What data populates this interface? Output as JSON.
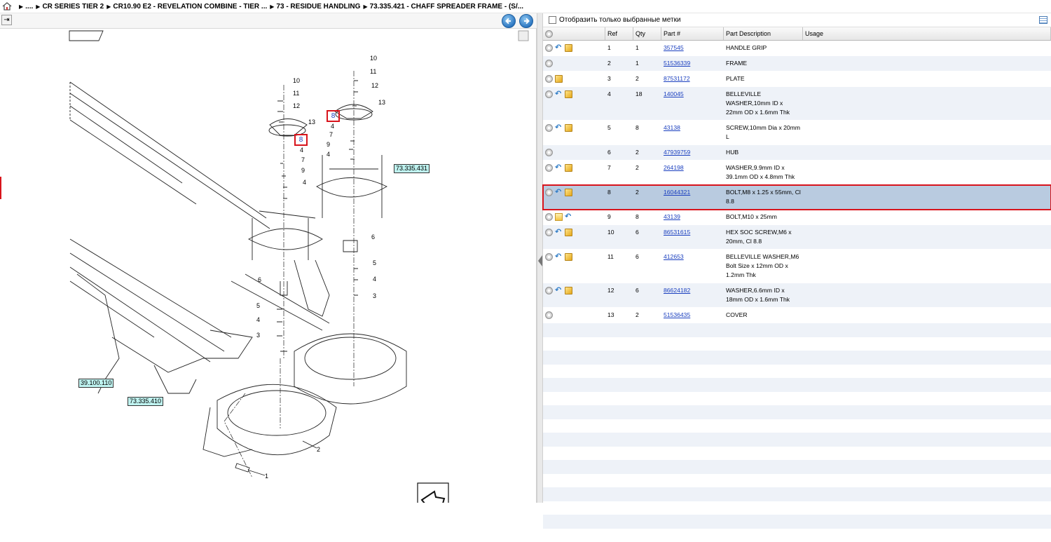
{
  "breadcrumb": {
    "items": [
      "....",
      "CR SERIES TIER 2",
      "CR10.90 E2 - REVELATION COMBINE - TIER ...",
      "73 - RESIDUE HANDLING",
      "73.335.421 - CHAFF SPREADER FRAME - (S/..."
    ]
  },
  "filter": {
    "label": "Отобразить только выбранные метки"
  },
  "table": {
    "columns": {
      "ref": "Ref",
      "qty": "Qty",
      "part": "Part #",
      "desc": "Part Description",
      "usage": "Usage"
    },
    "rows": [
      {
        "icons": [
          "plus-icon",
          "undo-icon",
          "box-icon"
        ],
        "ref": "1",
        "qty": "1",
        "part": "357545",
        "desc": "HANDLE GRIP",
        "usage": ""
      },
      {
        "icons": [
          "plus-icon"
        ],
        "ref": "2",
        "qty": "1",
        "part": "51536339",
        "desc": "FRAME",
        "usage": ""
      },
      {
        "icons": [
          "plus-icon",
          "box-icon"
        ],
        "ref": "3",
        "qty": "2",
        "part": "87531172",
        "desc": "PLATE",
        "usage": ""
      },
      {
        "icons": [
          "plus-icon",
          "undo-icon",
          "box-icon"
        ],
        "ref": "4",
        "qty": "18",
        "part": "140045",
        "desc": "BELLEVILLE WASHER,10mm ID x 22mm OD x 1.6mm Thk",
        "usage": ""
      },
      {
        "icons": [
          "plus-icon",
          "undo-icon",
          "box-icon"
        ],
        "ref": "5",
        "qty": "8",
        "part": "43138",
        "desc": "SCREW,10mm Dia x 20mm L",
        "usage": ""
      },
      {
        "icons": [
          "plus-icon"
        ],
        "ref": "6",
        "qty": "2",
        "part": "47939759",
        "desc": "HUB",
        "usage": ""
      },
      {
        "icons": [
          "plus-icon",
          "undo-icon",
          "box-icon"
        ],
        "ref": "7",
        "qty": "2",
        "part": "264198",
        "desc": "WASHER,9.9mm ID x 39.1mm OD x 4.8mm Thk",
        "usage": ""
      },
      {
        "icons": [
          "plus-icon",
          "undo-icon",
          "box-icon"
        ],
        "ref": "8",
        "qty": "2",
        "part": "16044321",
        "desc": "BOLT,M8 x 1.25 x 55mm, Cl 8.8",
        "usage": "",
        "selected": true
      },
      {
        "icons": [
          "plus-icon",
          "doc-icon",
          "undo-icon"
        ],
        "ref": "9",
        "qty": "8",
        "part": "43139",
        "desc": "BOLT,M10 x 25mm",
        "usage": ""
      },
      {
        "icons": [
          "plus-icon",
          "undo-icon",
          "box-icon"
        ],
        "ref": "10",
        "qty": "6",
        "part": "86531615",
        "desc": "HEX SOC SCREW,M6 x 20mm, Cl 8.8",
        "usage": ""
      },
      {
        "icons": [
          "plus-icon",
          "undo-icon",
          "box-icon"
        ],
        "ref": "11",
        "qty": "6",
        "part": "412653",
        "desc": "BELLEVILLE WASHER,M6 Bolt Size x 12mm OD x 1.2mm Thk",
        "usage": ""
      },
      {
        "icons": [
          "plus-icon",
          "undo-icon",
          "box-icon"
        ],
        "ref": "12",
        "qty": "6",
        "part": "86624182",
        "desc": "WASHER,6.6mm ID x 18mm OD x 1.6mm Thk",
        "usage": ""
      },
      {
        "icons": [
          "plus-icon"
        ],
        "ref": "13",
        "qty": "2",
        "part": "51536435",
        "desc": "COVER",
        "usage": ""
      }
    ]
  },
  "drawing": {
    "callouts": [
      "73.335.431",
      "39.100.110",
      "73.335.410"
    ],
    "markers": [
      "8",
      "8"
    ],
    "labels": [
      "10",
      "11",
      "12",
      "13",
      "10",
      "11",
      "12",
      "13",
      "4",
      "7",
      "9",
      "4",
      "4",
      "7",
      "9",
      "4",
      "6",
      "5",
      "4",
      "3",
      "6",
      "5",
      "4",
      "3",
      "2",
      "1"
    ]
  },
  "colors": {
    "accent_red": "#d8141c",
    "selected_row": "#b9cbe0",
    "link": "#1a3fbf",
    "callout_bg": "#bff3f0"
  }
}
